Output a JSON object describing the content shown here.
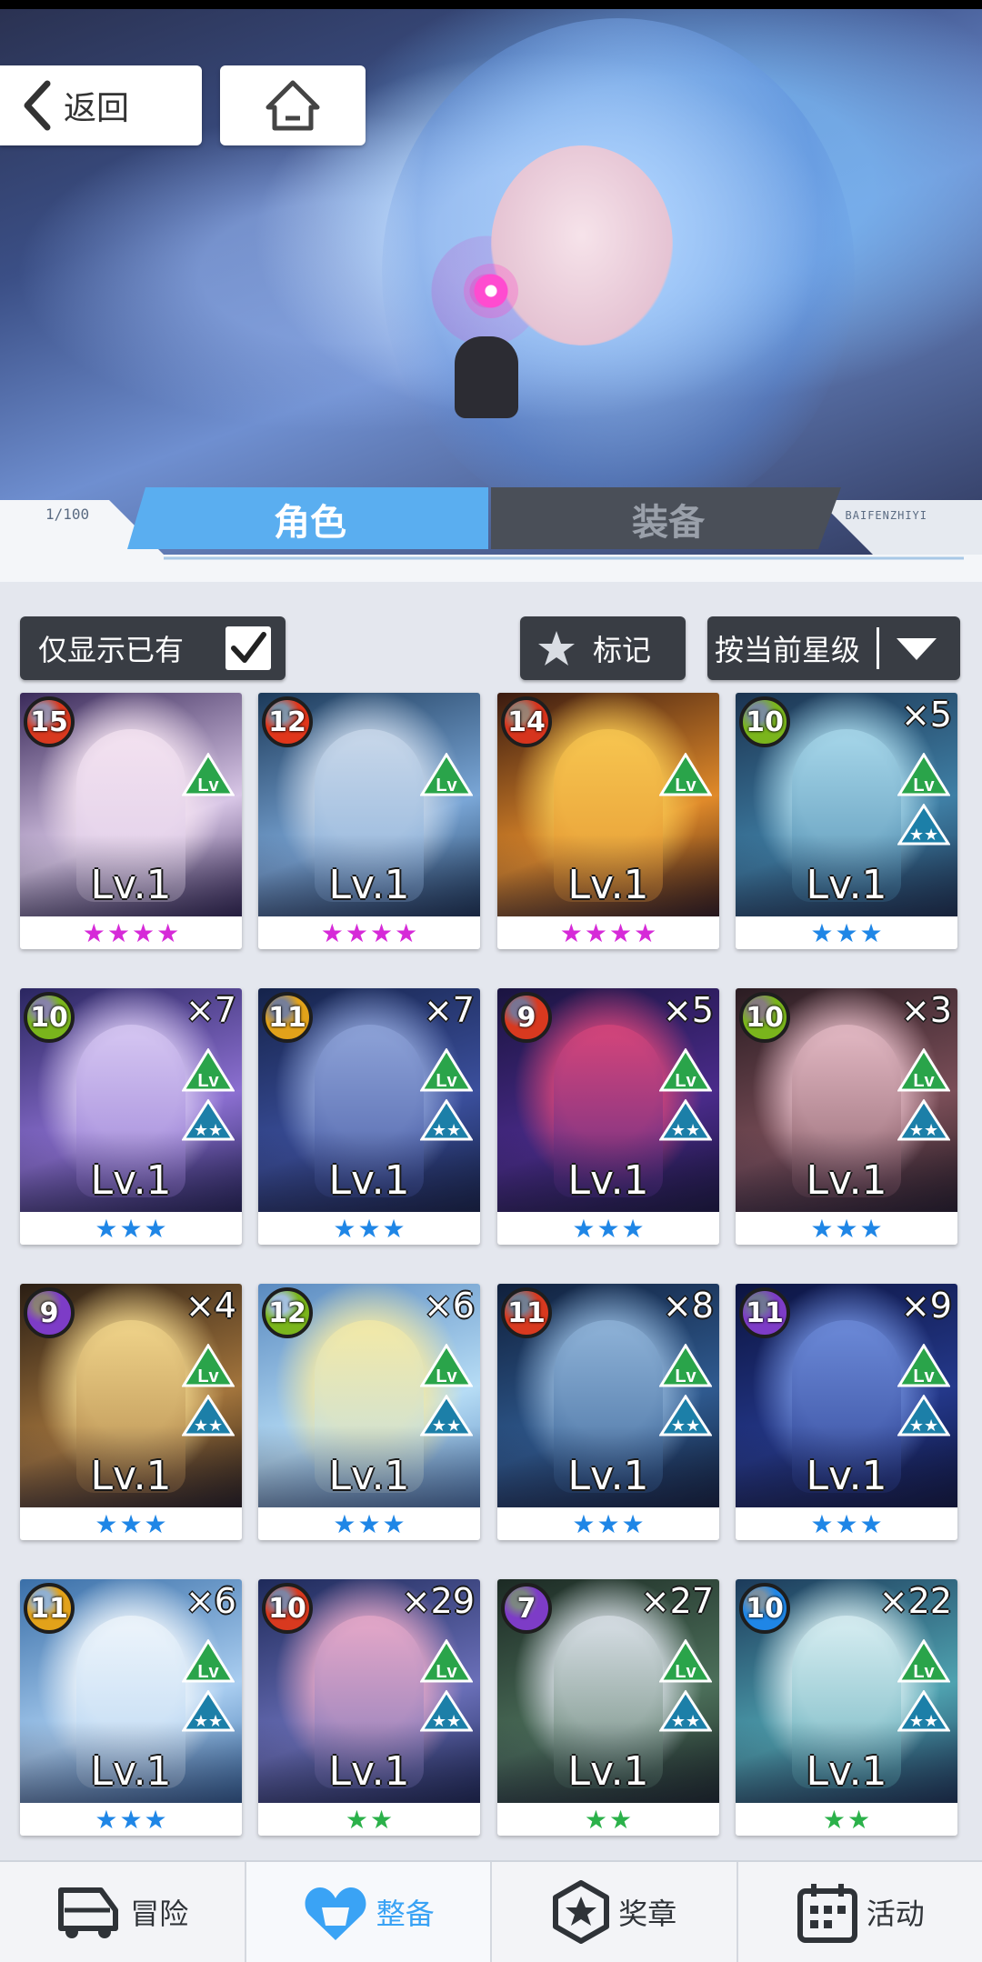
{
  "header": {
    "back_label": "返回",
    "capacity": "1/100",
    "brand": "BAIFENZHIYI"
  },
  "tabs": [
    {
      "label": "角色",
      "active": true
    },
    {
      "label": "装备",
      "active": false
    }
  ],
  "filters": {
    "owned_only_label": "仅显示已有",
    "owned_only_checked": true,
    "mark_label": "标记",
    "sort_label": "按当前星级"
  },
  "cards": [
    {
      "level": "15",
      "count": "",
      "lv": "Lv.1",
      "stars": 4,
      "star_color": "#d62ad8",
      "badge": "#d8391f",
      "art": [
        "#3a2a5a",
        "#d8c6e6",
        "#f3e2f0"
      ],
      "has_star_icon": false
    },
    {
      "level": "12",
      "count": "",
      "lv": "Lv.1",
      "stars": 4,
      "star_color": "#d62ad8",
      "badge": "#e0361b",
      "art": [
        "#1c3a5a",
        "#7aa6d6",
        "#c9d8ea"
      ],
      "has_star_icon": false
    },
    {
      "level": "14",
      "count": "",
      "lv": "Lv.1",
      "stars": 4,
      "star_color": "#d62ad8",
      "badge": "#d6341d",
      "art": [
        "#3a1a10",
        "#e08a2a",
        "#f7c650"
      ],
      "has_star_icon": false
    },
    {
      "level": "10",
      "count": "×5",
      "lv": "Lv.1",
      "stars": 3,
      "star_color": "#1f86e6",
      "badge": "#7ab51c",
      "art": [
        "#1b3350",
        "#3f7fa5",
        "#a7d7ea"
      ],
      "has_star_icon": true
    },
    {
      "level": "10",
      "count": "×7",
      "lv": "Lv.1",
      "stars": 3,
      "star_color": "#1f86e6",
      "badge": "#7ab51c",
      "art": [
        "#2a2660",
        "#8b6fd0",
        "#d6c7f2"
      ],
      "has_star_icon": true
    },
    {
      "level": "11",
      "count": "×7",
      "lv": "Lv.1",
      "stars": 3,
      "star_color": "#1f86e6",
      "badge": "#e2a21a",
      "art": [
        "#15234a",
        "#3b4f9c",
        "#8ea3d8"
      ],
      "has_star_icon": true
    },
    {
      "level": "9",
      "count": "×5",
      "lv": "Lv.1",
      "stars": 3,
      "star_color": "#1f86e6",
      "badge": "#d8391f",
      "art": [
        "#1a1440",
        "#4a2b8a",
        "#d6457a"
      ],
      "has_star_icon": true
    },
    {
      "level": "10",
      "count": "×3",
      "lv": "Lv.1",
      "stars": 3,
      "star_color": "#1f86e6",
      "badge": "#7ab51c",
      "art": [
        "#2a1c22",
        "#7a4e58",
        "#e3b9c4"
      ],
      "has_star_icon": true
    },
    {
      "level": "9",
      "count": "×4",
      "lv": "Lv.1",
      "stars": 3,
      "star_color": "#1f86e6",
      "badge": "#7d3cc7",
      "art": [
        "#2a1e14",
        "#a2743c",
        "#f0d48a"
      ],
      "has_star_icon": true
    },
    {
      "level": "12",
      "count": "×6",
      "lv": "Lv.1",
      "stars": 3,
      "star_color": "#1f86e6",
      "badge": "#7ab51c",
      "art": [
        "#5a8ac0",
        "#b6dcf5",
        "#f3e9a6"
      ],
      "has_star_icon": true
    },
    {
      "level": "11",
      "count": "×8",
      "lv": "Lv.1",
      "stars": 3,
      "star_color": "#1f86e6",
      "badge": "#d8391f",
      "art": [
        "#10203c",
        "#2f5a8f",
        "#8fb3d8"
      ],
      "has_star_icon": true
    },
    {
      "level": "11",
      "count": "×9",
      "lv": "Lv.1",
      "stars": 3,
      "star_color": "#1f86e6",
      "badge": "#7d3cc7",
      "art": [
        "#0c1440",
        "#24388a",
        "#6c8ad8"
      ],
      "has_star_icon": true
    },
    {
      "level": "11",
      "count": "×6",
      "lv": "Lv.1",
      "stars": 3,
      "star_color": "#1f86e6",
      "badge": "#e2a21a",
      "art": [
        "#3a6fa8",
        "#a9cdf0",
        "#eef5fb"
      ],
      "has_star_icon": true
    },
    {
      "level": "10",
      "count": "×29",
      "lv": "Lv.1",
      "stars": 2,
      "star_color": "#2bb14a",
      "badge": "#d8391f",
      "art": [
        "#1e2a5a",
        "#6a6fb8",
        "#e6a8c8"
      ],
      "has_star_icon": true
    },
    {
      "level": "7",
      "count": "×27",
      "lv": "Lv.1",
      "stars": 2,
      "star_color": "#2bb14a",
      "badge": "#7d3cc7",
      "art": [
        "#1c2a24",
        "#4c6f5a",
        "#d8dfe6"
      ],
      "has_star_icon": true
    },
    {
      "level": "10",
      "count": "×22",
      "lv": "Lv.1",
      "stars": 2,
      "star_color": "#2bb14a",
      "badge": "#1f86e6",
      "art": [
        "#1c3a5a",
        "#4fa2b0",
        "#d8eef2"
      ],
      "has_star_icon": true
    }
  ],
  "nav": [
    {
      "label": "冒险",
      "icon": "truck-icon",
      "active": false
    },
    {
      "label": "整备",
      "icon": "heart-shield-icon",
      "active": true
    },
    {
      "label": "奖章",
      "icon": "medal-icon",
      "active": false
    },
    {
      "label": "活动",
      "icon": "calendar-icon",
      "active": false
    }
  ],
  "colors": {
    "accent": "#3aa3f5",
    "tab_active": "#4ba6ec",
    "chip_bg": "#393d44"
  }
}
